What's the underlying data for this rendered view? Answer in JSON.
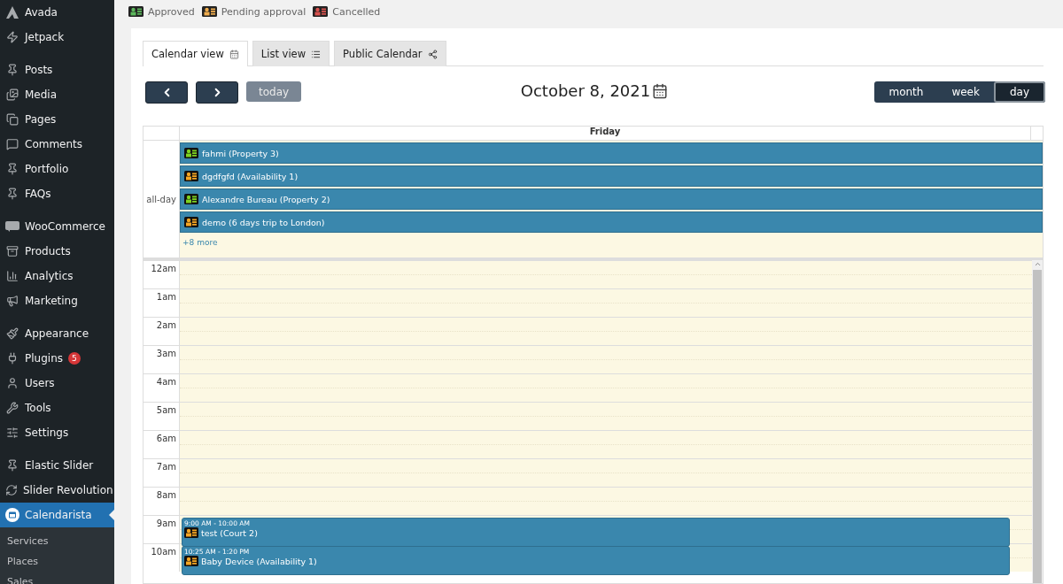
{
  "sidebar": {
    "sections": [
      [
        {
          "label": "Avada",
          "selected": false
        },
        {
          "label": "Jetpack",
          "selected": false
        }
      ],
      [
        {
          "label": "Posts",
          "selected": false
        },
        {
          "label": "Media",
          "selected": false
        },
        {
          "label": "Pages",
          "selected": false
        },
        {
          "label": "Comments",
          "selected": false
        },
        {
          "label": "Portfolio",
          "selected": false
        },
        {
          "label": "FAQs",
          "selected": false
        }
      ],
      [
        {
          "label": "WooCommerce",
          "selected": false
        },
        {
          "label": "Products",
          "selected": false
        },
        {
          "label": "Analytics",
          "selected": false
        },
        {
          "label": "Marketing",
          "selected": false
        }
      ],
      [
        {
          "label": "Appearance",
          "selected": false
        },
        {
          "label": "Plugins",
          "selected": false,
          "badge": "5"
        },
        {
          "label": "Users",
          "selected": false
        },
        {
          "label": "Tools",
          "selected": false
        },
        {
          "label": "Settings",
          "selected": false
        }
      ],
      [
        {
          "label": "Elastic Slider",
          "selected": false
        },
        {
          "label": "Slider Revolution",
          "selected": false
        },
        {
          "label": "Calendarista",
          "selected": true,
          "children": [
            {
              "label": "Services"
            },
            {
              "label": "Places"
            },
            {
              "label": "Sales"
            }
          ]
        }
      ]
    ]
  },
  "legend": [
    {
      "label": "Approved",
      "color": "#5cb85c"
    },
    {
      "label": "Pending approval",
      "color": "#f0ad4e"
    },
    {
      "label": "Cancelled",
      "color": "#d9534f"
    }
  ],
  "tabs": [
    {
      "label": "Calendar view",
      "selected": true
    },
    {
      "label": "List view",
      "selected": false
    },
    {
      "label": "Public Calendar",
      "selected": false
    }
  ],
  "toolbar": {
    "today": {
      "label": "today",
      "disabled": true
    },
    "title": "October 8, 2021",
    "views": [
      {
        "label": "month",
        "selected": false
      },
      {
        "label": "week",
        "selected": false
      },
      {
        "label": "day",
        "selected": true
      }
    ]
  },
  "calendar": {
    "day_header": "Friday",
    "all_day_label": "all-day",
    "all_day_events": [
      {
        "title": "fahmi (Property 3)",
        "color": "#7ed321"
      },
      {
        "title": "dgdfgfd (Availability 1)",
        "color": "#f5a623"
      },
      {
        "title": "Alexandre Bureau (Property 2)",
        "color": "#7ed321"
      },
      {
        "title": "demo (6 days trip to London)",
        "color": "#f5a623"
      }
    ],
    "more_link": "+8 more",
    "hours": [
      {
        "label": "12am"
      },
      {
        "label": "1am"
      },
      {
        "label": "2am"
      },
      {
        "label": "3am"
      },
      {
        "label": "4am"
      },
      {
        "label": "5am"
      },
      {
        "label": "6am"
      },
      {
        "label": "7am"
      },
      {
        "label": "8am"
      },
      {
        "label": "9am",
        "events": [
          {
            "time": "9:00 AM - 10:00 AM",
            "title": "test (Court 2)",
            "color": "#f5a623"
          }
        ]
      },
      {
        "label": "10am",
        "events": [
          {
            "time": "10:25 AM - 1:20 PM",
            "title": "Baby Device (Availability 1)",
            "color": "#f5a623"
          }
        ]
      }
    ]
  }
}
